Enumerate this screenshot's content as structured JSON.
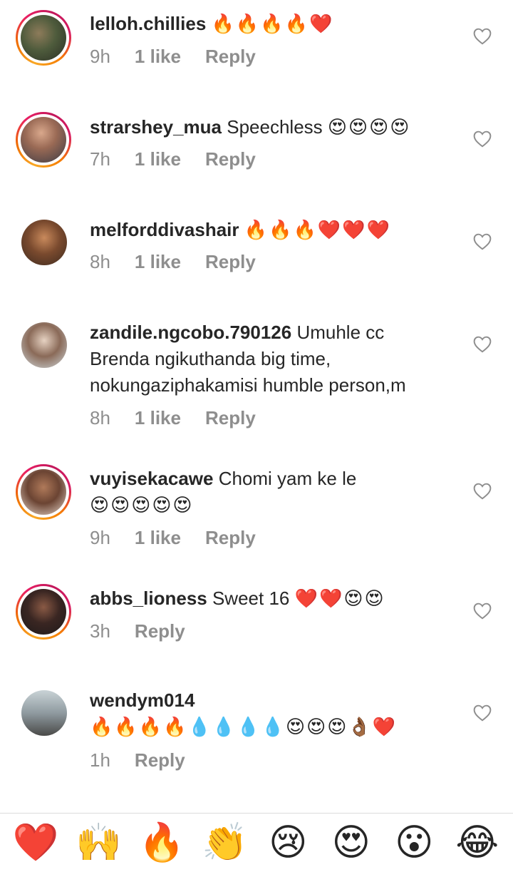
{
  "comments": [
    {
      "username": "lelloh.chillies",
      "text": "",
      "emoji": "🔥🔥🔥🔥❤️",
      "time": "9h",
      "likes": "1 like",
      "reply": "Reply"
    },
    {
      "username": "strarshey_mua",
      "text": "Speechless",
      "emoji": "😍😍😍😍",
      "time": "7h",
      "likes": "1 like",
      "reply": "Reply"
    },
    {
      "username": "melforddivashair",
      "text": "",
      "emoji": "🔥🔥🔥❤️❤️❤️",
      "time": "8h",
      "likes": "1 like",
      "reply": "Reply"
    },
    {
      "username": "zandile.ngcobo.790126",
      "text": "Umuhle cc",
      "text_line2": "Brenda ngikuthanda big time,",
      "text_line3": "nokungaziphakamisi humble person,m",
      "time": "8h",
      "likes": "1 like",
      "reply": "Reply"
    },
    {
      "username": "vuyisekacawe",
      "text": "Chomi yam ke le",
      "emoji_line2": "😍😍😍😍😍",
      "time": "9h",
      "likes": "1 like",
      "reply": "Reply"
    },
    {
      "username": "abbs_lioness",
      "text": "Sweet 16",
      "emoji": "❤️❤️😍😍",
      "time": "3h",
      "reply": "Reply"
    },
    {
      "username": "wendym014",
      "emoji_line2": "🔥🔥🔥🔥💧💧💧💧😍😍😍👌🏾❤️",
      "time": "1h",
      "reply": "Reply"
    }
  ],
  "reactions": [
    "❤️",
    "🙌",
    "🔥",
    "👏",
    "😢",
    "😍",
    "😮",
    "😂"
  ],
  "icons": {
    "like": "heart-outline-icon"
  },
  "colors": {
    "meta": "#8e8e8e",
    "text": "#262626",
    "border": "#dbdbdb"
  }
}
